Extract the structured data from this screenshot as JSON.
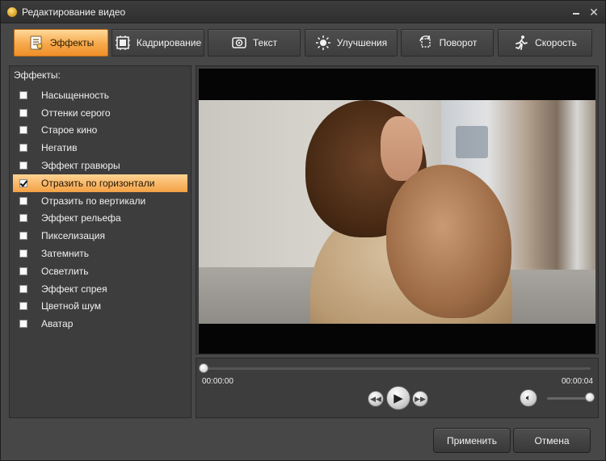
{
  "window": {
    "title": "Редактирование видео"
  },
  "tabs": [
    {
      "label": "Эффекты",
      "icon": "effects-icon",
      "active": true
    },
    {
      "label": "Кадрирование",
      "icon": "crop-icon",
      "active": false
    },
    {
      "label": "Текст",
      "icon": "text-icon",
      "active": false
    },
    {
      "label": "Улучшения",
      "icon": "brightness-icon",
      "active": false
    },
    {
      "label": "Поворот",
      "icon": "rotate-icon",
      "active": false
    },
    {
      "label": "Скорость",
      "icon": "running-man-icon",
      "active": false
    }
  ],
  "effects": {
    "title": "Эффекты:",
    "items": [
      {
        "label": "Насыщенность",
        "checked": false
      },
      {
        "label": "Оттенки серого",
        "checked": false
      },
      {
        "label": "Старое кино",
        "checked": false
      },
      {
        "label": "Негатив",
        "checked": false
      },
      {
        "label": "Эффект гравюры",
        "checked": false
      },
      {
        "label": "Отразить по горизонтали",
        "checked": true
      },
      {
        "label": "Отразить по вертикали",
        "checked": false
      },
      {
        "label": "Эффект рельефа",
        "checked": false
      },
      {
        "label": "Пикселизация",
        "checked": false
      },
      {
        "label": "Затемнить",
        "checked": false
      },
      {
        "label": "Осветлить",
        "checked": false
      },
      {
        "label": "Эффект спрея",
        "checked": false
      },
      {
        "label": "Цветной шум",
        "checked": false
      },
      {
        "label": "Аватар",
        "checked": false
      }
    ]
  },
  "player": {
    "current_time": "00:00:00",
    "total_time": "00:00:04",
    "progress": 0,
    "volume": 1.0
  },
  "buttons": {
    "apply": "Применить",
    "cancel": "Отмена"
  },
  "colors": {
    "accent": "#f3a145",
    "background": "#474747",
    "panel": "#3d3d3d"
  }
}
